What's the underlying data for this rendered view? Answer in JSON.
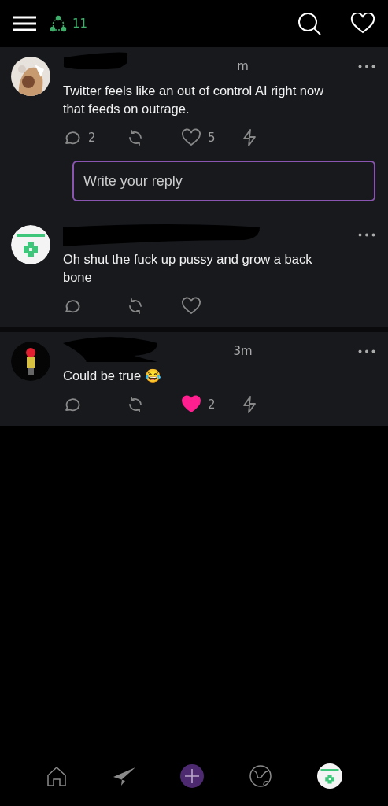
{
  "top_bar": {
    "notification_count": "11"
  },
  "posts": [
    {
      "time": "m",
      "text": "Twitter feels like an out of control AI right now that feeds on outrage.",
      "replies": "2",
      "likes": "5",
      "liked": false,
      "zap": true,
      "reply_field": {
        "placeholder": "Write your reply"
      }
    },
    {
      "avatar": {
        "kind": "logo"
      },
      "text": "Oh shut the fuck up pussy and grow a back bone",
      "liked": false,
      "zap": false
    },
    {
      "avatar": {
        "kind": "figure"
      },
      "time": "3m",
      "text": "Could be true 😂",
      "likes": "2",
      "liked": true,
      "zap": true,
      "divider_above": true
    }
  ],
  "bottom_nav": [
    {
      "kind": "home"
    },
    {
      "kind": "send"
    },
    {
      "kind": "compose"
    },
    {
      "kind": "globe"
    },
    {
      "kind": "profile"
    }
  ]
}
